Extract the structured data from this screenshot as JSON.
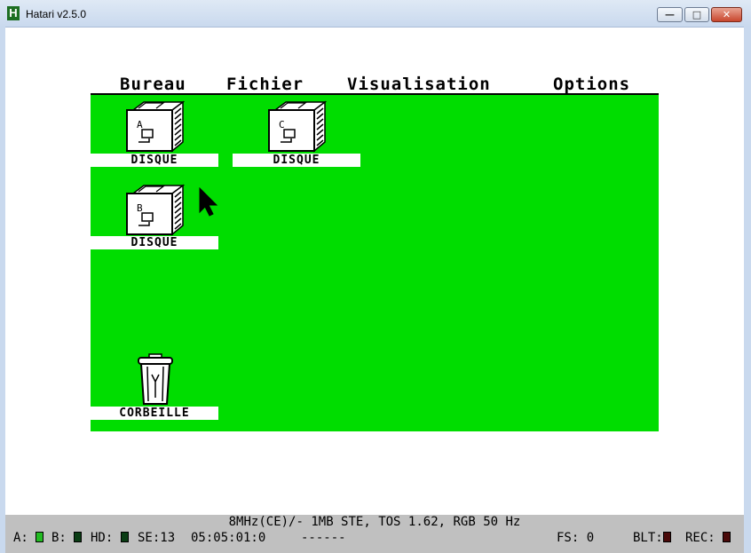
{
  "window": {
    "title": "Hatari v2.5.0",
    "app_icon": "H",
    "minimize": "—",
    "maximize": "□",
    "close": "✕"
  },
  "menu": [
    {
      "label": "Bureau"
    },
    {
      "label": "Fichier"
    },
    {
      "label": "Visualisation"
    },
    {
      "label": "Options"
    }
  ],
  "desktop": {
    "color": "#00dd00",
    "icons": [
      {
        "label": "DISQUE",
        "letter": "A",
        "kind": "drawer-icon"
      },
      {
        "label": "DISQUE",
        "letter": "C",
        "kind": "drawer-icon"
      },
      {
        "label": "DISQUE",
        "letter": "B",
        "kind": "drawer-icon"
      },
      {
        "label": "CORBEILLE",
        "kind": "trash-icon"
      }
    ]
  },
  "status": {
    "line1": "8MHz(CE)/- 1MB STE, TOS 1.62, RGB 50 Hz",
    "a_label": "A:",
    "a_led_color": "#22bb22",
    "b_label": "B:",
    "b_led_color": "#0a3d14",
    "hd_label": "HD:",
    "hd_led_color": "#0a3d14",
    "se": "SE:13",
    "time": "05:05:01:0",
    "dashes": "------",
    "fs": "FS: 0",
    "blt_label": "BLT:",
    "blt_led_color": "#4a0a0a",
    "rec_label": "REC:",
    "rec_led_color": "#4a0a0a"
  }
}
